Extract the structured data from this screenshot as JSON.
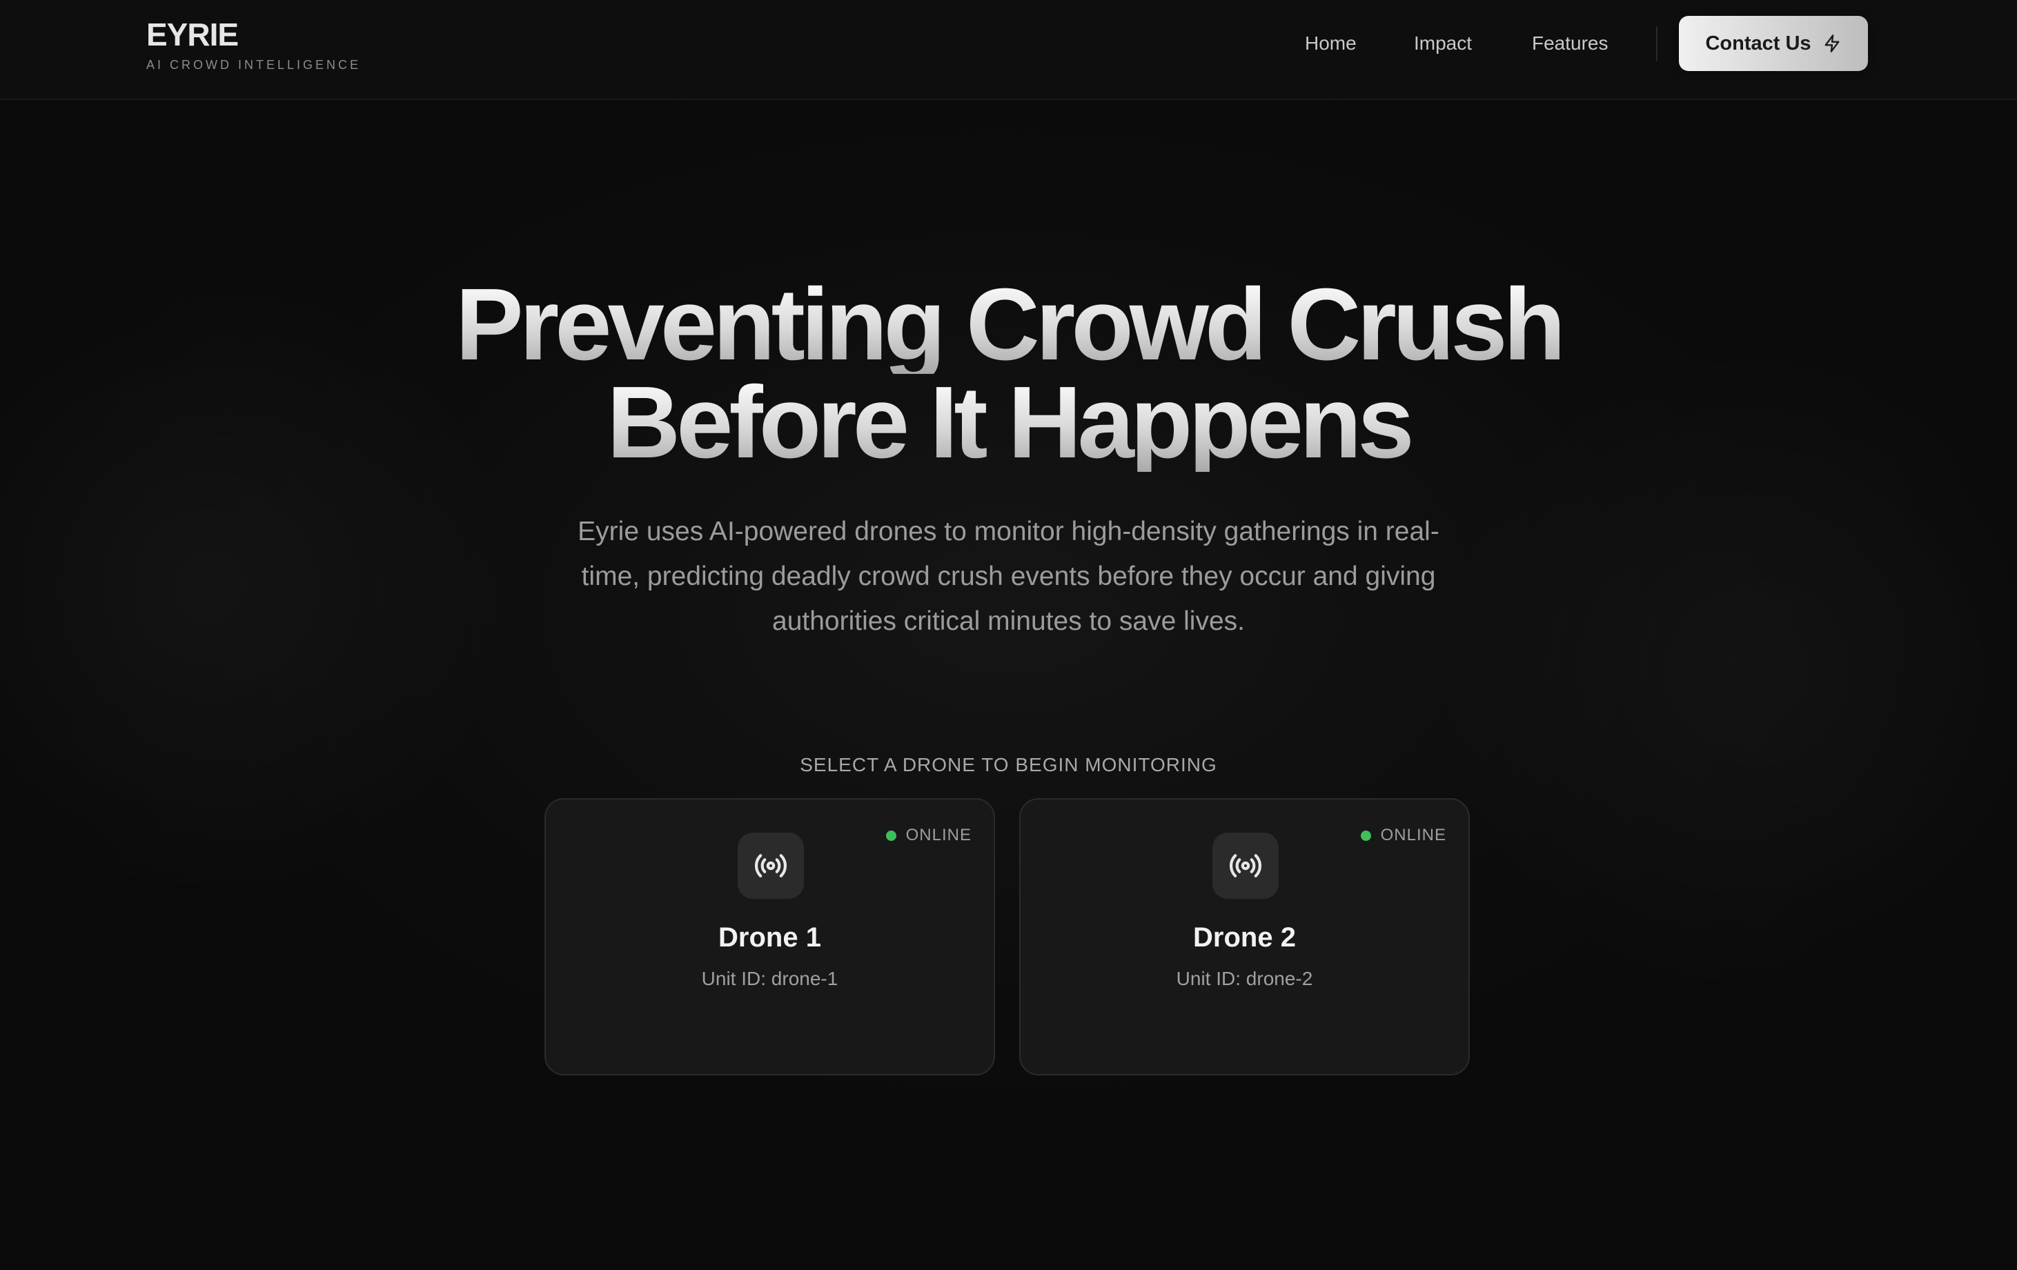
{
  "brand": {
    "name": "EYRIE",
    "tagline": "AI CROWD INTELLIGENCE"
  },
  "nav": {
    "items": [
      {
        "label": "Home"
      },
      {
        "label": "Impact"
      },
      {
        "label": "Features"
      }
    ],
    "cta_label": "Contact Us",
    "cta_icon": "lightning-icon"
  },
  "hero": {
    "title_line1": "Preventing Crowd Crush",
    "title_line2": "Before It Happens",
    "subtitle": "Eyrie uses AI-powered drones to monitor high-density gatherings in real-time, predicting deadly crowd crush events before they occur and giving authorities critical minutes to save lives."
  },
  "drones": {
    "prompt": "SELECT A DRONE TO BEGIN MONITORING",
    "items": [
      {
        "name": "Drone 1",
        "unit": "Unit ID: drone-1",
        "status": "ONLINE",
        "icon": "broadcast-icon"
      },
      {
        "name": "Drone 2",
        "unit": "Unit ID: drone-2",
        "status": "ONLINE",
        "icon": "broadcast-icon"
      }
    ]
  },
  "colors": {
    "background": "#0b0b0b",
    "card": "#181818",
    "online": "#3fbf5a",
    "cta_start": "#f0f0f0",
    "cta_end": "#bdbdbd"
  }
}
